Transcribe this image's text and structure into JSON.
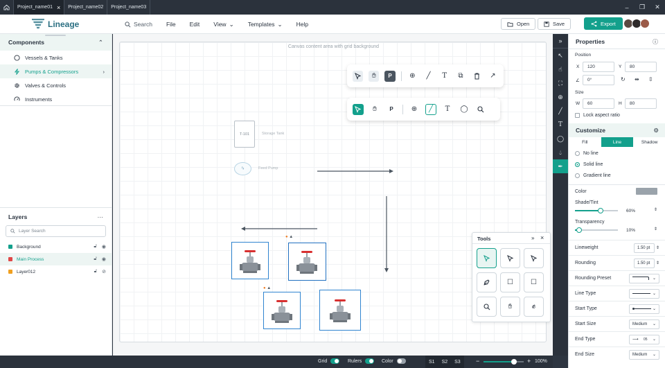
{
  "tabs": [
    {
      "label": "Project_name01",
      "active": true
    },
    {
      "label": "Project_name02",
      "active": false
    },
    {
      "label": "Project_name03",
      "active": false
    }
  ],
  "app": {
    "name": "Lineage"
  },
  "menu": {
    "search": "Search",
    "file": "File",
    "edit": "Edit",
    "view": "View",
    "templates": "Templates",
    "help": "Help"
  },
  "actions": {
    "open": "Open",
    "save": "Save",
    "export": "Export"
  },
  "components": {
    "title": "Components",
    "items": [
      {
        "label": "Vessels & Tanks",
        "icon": "circle-icon"
      },
      {
        "label": "Pumps & Compressors",
        "icon": "bolt-icon",
        "active": true
      },
      {
        "label": "Valves & Controls",
        "icon": "gear-icon"
      },
      {
        "label": "Instruments",
        "icon": "gauge-icon"
      }
    ]
  },
  "layers": {
    "title": "Layers",
    "search_placeholder": "Layer Search",
    "items": [
      {
        "label": "Background",
        "color": "#13a08c"
      },
      {
        "label": "Main Process",
        "color": "#e04848",
        "active": true
      },
      {
        "label": "Layer012",
        "color": "#f0a020"
      }
    ]
  },
  "canvas": {
    "caption": "Canvas content area with grid background",
    "tank_label": "T-101",
    "tank_caption": "Storage Tank",
    "pump_caption": "Feed Pump"
  },
  "tools_panel": {
    "title": "Tools"
  },
  "properties": {
    "title": "Properties",
    "position_label": "Position",
    "x_label": "X",
    "x": "120",
    "y_label": "Y",
    "y": "80",
    "angle": "0°",
    "size_label": "Size",
    "w_label": "W",
    "w": "60",
    "h_label": "H",
    "h": "80",
    "lock_aspect": "Lock aspect ratio"
  },
  "customize": {
    "title": "Customize",
    "tabs": [
      "Fill",
      "Line",
      "Shadow"
    ],
    "active_tab": "Line",
    "line_options": [
      "No line",
      "Solid line",
      "Gradient line"
    ],
    "selected_option": "Solid line",
    "color_label": "Color",
    "color_value": "#9aa3ab",
    "shade_label": "Shade/Tint",
    "shade_value": "60%",
    "shade_level": 0.6,
    "transparency_label": "Transparency",
    "transparency_value": "10%",
    "transparency_level": 0.1,
    "lineweight_label": "Lineweight",
    "lineweight_value": "1.50 pt",
    "rounding_label": "Rounding",
    "rounding_value": "1.50 pt",
    "rounding_preset_label": "Rounding Preset",
    "line_type_label": "Line Type",
    "start_type_label": "Start Type",
    "start_size_label": "Start Size",
    "start_size_value": "Medium",
    "end_type_label": "End Type",
    "end_type_value": "05",
    "end_size_label": "End Size",
    "end_size_value": "Medium"
  },
  "statusbar": {
    "grid": "Grid",
    "grid_on": true,
    "rulers": "Rulers",
    "rulers_on": true,
    "color": "Color",
    "color_on": false,
    "scenes": [
      "S1",
      "S2",
      "S3"
    ],
    "zoom_minus": "−",
    "zoom_plus": "+",
    "zoom": "100%",
    "zoom_level": 0.75
  }
}
